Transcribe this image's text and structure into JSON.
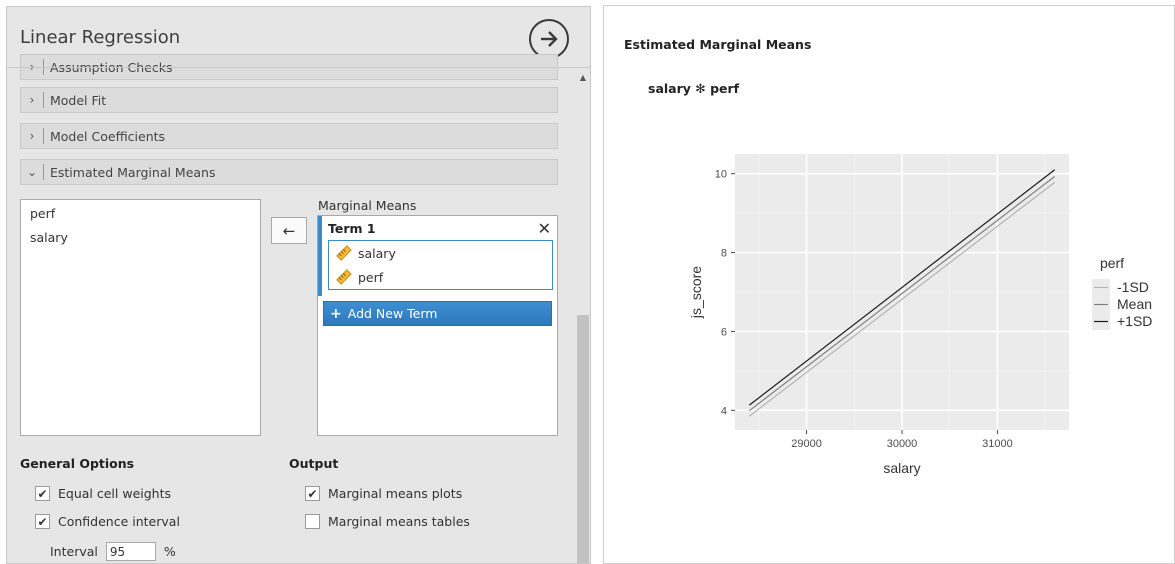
{
  "panel": {
    "title": "Linear Regression",
    "sections": [
      {
        "label": "Assumption Checks",
        "chevron": "›"
      },
      {
        "label": "Model Fit",
        "chevron": "›"
      },
      {
        "label": "Model Coefficients",
        "chevron": "›"
      },
      {
        "label": "Estimated Marginal Means",
        "chevron": "⌄"
      }
    ],
    "variables": [
      "perf",
      "salary"
    ],
    "move_arrow": "←",
    "marginal_means": {
      "label": "Marginal Means",
      "term_title": "Term 1",
      "close_glyph": "✕",
      "term_items": [
        "salary",
        "perf"
      ],
      "add_button": "Add New Term",
      "add_glyph": "+"
    },
    "general_options": {
      "heading": "General Options",
      "equal_cell_weights": {
        "label": "Equal cell weights",
        "checked": true,
        "glyph": "✔"
      },
      "confidence_interval": {
        "label": "Confidence interval",
        "checked": true,
        "glyph": "✔"
      },
      "interval_label": "Interval",
      "interval_value": "95",
      "interval_unit": "%"
    },
    "output": {
      "heading": "Output",
      "marginal_means_plots": {
        "label": "Marginal means plots",
        "checked": true,
        "glyph": "✔"
      },
      "marginal_means_tables": {
        "label": "Marginal means tables",
        "checked": false,
        "glyph": ""
      }
    },
    "scroll_up_glyph": "▲"
  },
  "results": {
    "title": "Estimated Marginal Means",
    "plot_title": "salary ✻ perf"
  },
  "colors": {
    "accent": "#3b8bcb",
    "plot_bg": "#ebebeb",
    "grid": "#ffffff",
    "series_low": "#b3b3b3",
    "series_mean": "#808080",
    "series_high": "#1a1a1a"
  },
  "chart_data": {
    "type": "line",
    "title": "salary ✻ perf",
    "xlabel": "salary",
    "ylabel": "js_score",
    "xlim": [
      28250,
      31750
    ],
    "ylim": [
      3.5,
      10.5
    ],
    "x_ticks": [
      29000,
      30000,
      31000
    ],
    "y_ticks": [
      4,
      6,
      8,
      10
    ],
    "grid": true,
    "legend_title": "perf",
    "legend_position": "right",
    "x": [
      28400,
      31600
    ],
    "series": [
      {
        "name": "-1SD",
        "values": [
          3.85,
          9.78
        ],
        "color": "#b3b3b3"
      },
      {
        "name": "Mean",
        "values": [
          3.99,
          9.93
        ],
        "color": "#808080"
      },
      {
        "name": "+1SD",
        "values": [
          4.13,
          10.1
        ],
        "color": "#1a1a1a"
      }
    ]
  }
}
